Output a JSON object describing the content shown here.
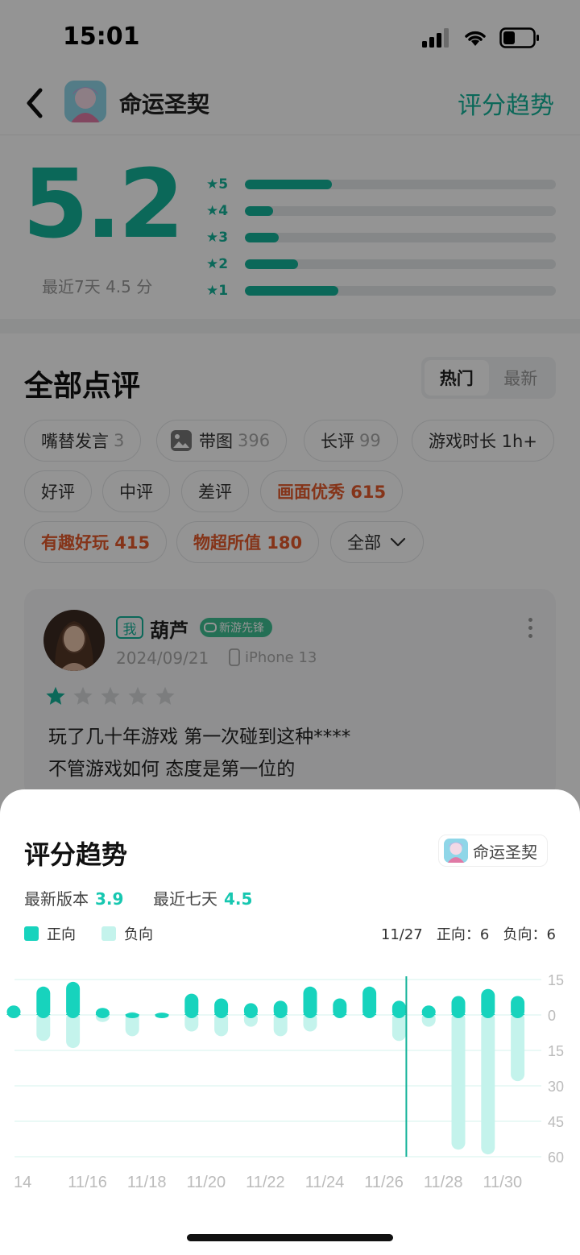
{
  "status_bar": {
    "time": "15:01"
  },
  "header": {
    "app_name": "命运圣契",
    "trend_link": "评分趋势"
  },
  "rating": {
    "score": "5.2",
    "recent_label": "最近7天 4.5 分",
    "distribution": [
      {
        "star": "★5",
        "fraction": 0.28
      },
      {
        "star": "★4",
        "fraction": 0.09
      },
      {
        "star": "★3",
        "fraction": 0.11
      },
      {
        "star": "★2",
        "fraction": 0.17
      },
      {
        "star": "★1",
        "fraction": 0.3
      }
    ],
    "accent_color": "#14b39a"
  },
  "reviews": {
    "title": "全部点评",
    "sort": {
      "hot": "热门",
      "latest": "最新"
    },
    "chips": [
      {
        "label": "嘴替发言",
        "count": "3"
      },
      {
        "label": "带图",
        "count": "396"
      },
      {
        "label": "长评",
        "count": "99"
      },
      {
        "label": "游戏时长 1h+",
        "count": ""
      },
      {
        "label": "好评",
        "count": ""
      },
      {
        "label": "中评",
        "count": ""
      },
      {
        "label": "差评",
        "count": ""
      },
      {
        "label": "画面优秀 615",
        "count": ""
      },
      {
        "label": "有趣好玩 415",
        "count": ""
      },
      {
        "label": "物超所值 180",
        "count": ""
      },
      {
        "label": "全部",
        "count": ""
      }
    ],
    "card": {
      "me_badge": "我",
      "user_name": "葫芦",
      "pioneer_badge": "新游先锋",
      "date": "2024/09/21",
      "device": "iPhone 13",
      "stars": 1,
      "lines": [
        "玩了几十年游戏 第一次碰到这种****",
        "不管游戏如何 态度是第一位的"
      ]
    }
  },
  "sheet": {
    "title": "评分趋势",
    "app_name": "命运圣契",
    "version_label": "最新版本",
    "version_score": "3.9",
    "recent_label": "最近七天",
    "recent_score": "4.5",
    "legend_positive": "正向",
    "legend_negative": "负向",
    "tooltip": "11/27   正向：6   负向：6"
  },
  "chart_data": {
    "type": "bar",
    "title": "评分趋势",
    "x": [
      "11/14",
      "11/15",
      "11/16",
      "11/17",
      "11/18",
      "11/19",
      "11/20",
      "11/21",
      "11/22",
      "11/23",
      "11/24",
      "11/25",
      "11/26",
      "11/27",
      "11/28",
      "11/29",
      "11/30",
      "12/01"
    ],
    "x_tick_labels": [
      "14",
      "11/16",
      "11/18",
      "11/20",
      "11/22",
      "11/24",
      "11/26",
      "11/28",
      "11/30"
    ],
    "series": [
      {
        "name": "正向",
        "color": "#17d3bd",
        "values": [
          4,
          12,
          14,
          3,
          1,
          1,
          9,
          7,
          5,
          6,
          12,
          7,
          12,
          6,
          4,
          8,
          11,
          8
        ]
      },
      {
        "name": "负向",
        "color": "#c4f3ec",
        "values": [
          0,
          11,
          14,
          3,
          9,
          0,
          7,
          9,
          5,
          9,
          7,
          0,
          0,
          11,
          5,
          57,
          59,
          28
        ]
      }
    ],
    "y_tick_labels": [
      "15",
      "0",
      "15",
      "30",
      "45",
      "60"
    ],
    "ylim": [
      -60,
      15
    ],
    "highlight": "11/27",
    "grid": true
  }
}
